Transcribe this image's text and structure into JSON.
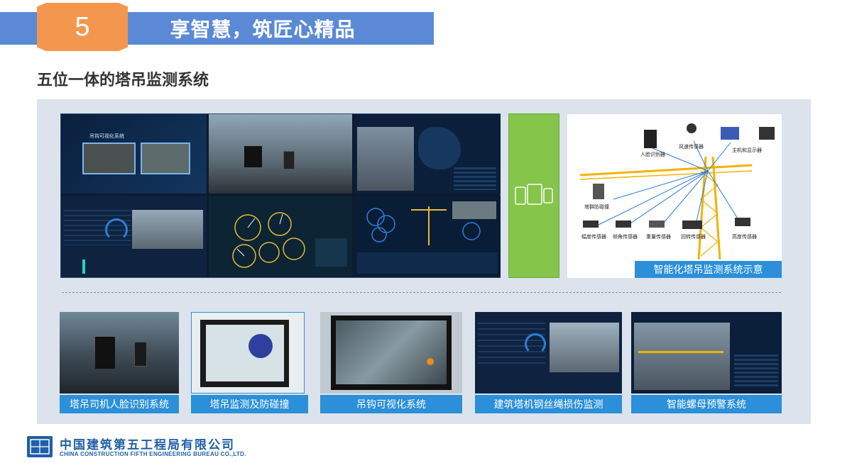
{
  "header": {
    "number": "5",
    "title": "享智慧，筑匠心精品"
  },
  "section_title": "五位一体的塔吊监测系统",
  "diagram": {
    "caption": "智能化塔吊监测系统示意",
    "labels": {
      "face": "人脸识别器",
      "wind": "风速传感器",
      "host": "主机和显示器",
      "tower_anti": "塔群防碰撞",
      "amplitude": "幅度传感器",
      "tilt": "倾角传感器",
      "weight": "重量传感器",
      "rotate": "回转传感器",
      "height": "高度传感器"
    }
  },
  "collage": {
    "hook_title": "吊钩可视化系统"
  },
  "thumbnails": [
    {
      "caption": "塔吊司机人脸识别系统"
    },
    {
      "caption": "塔吊监测及防碰撞"
    },
    {
      "caption": "吊钩可视化系统"
    },
    {
      "caption": "建筑塔机钢丝绳损伤监测"
    },
    {
      "caption": "智能螺母预警系统"
    }
  ],
  "footer": {
    "company_cn": "中国建筑第五工程局有限公司",
    "company_en": "CHINA CONSTRUCTION FIFTH ENGINEERING BUREAU CO.,LTD."
  },
  "colors": {
    "banner_blue": "#5b89d6",
    "badge_orange": "#f4974e",
    "caption_blue": "#2b8fd9",
    "green": "#84c54a",
    "brand_blue": "#1f5fa8"
  }
}
